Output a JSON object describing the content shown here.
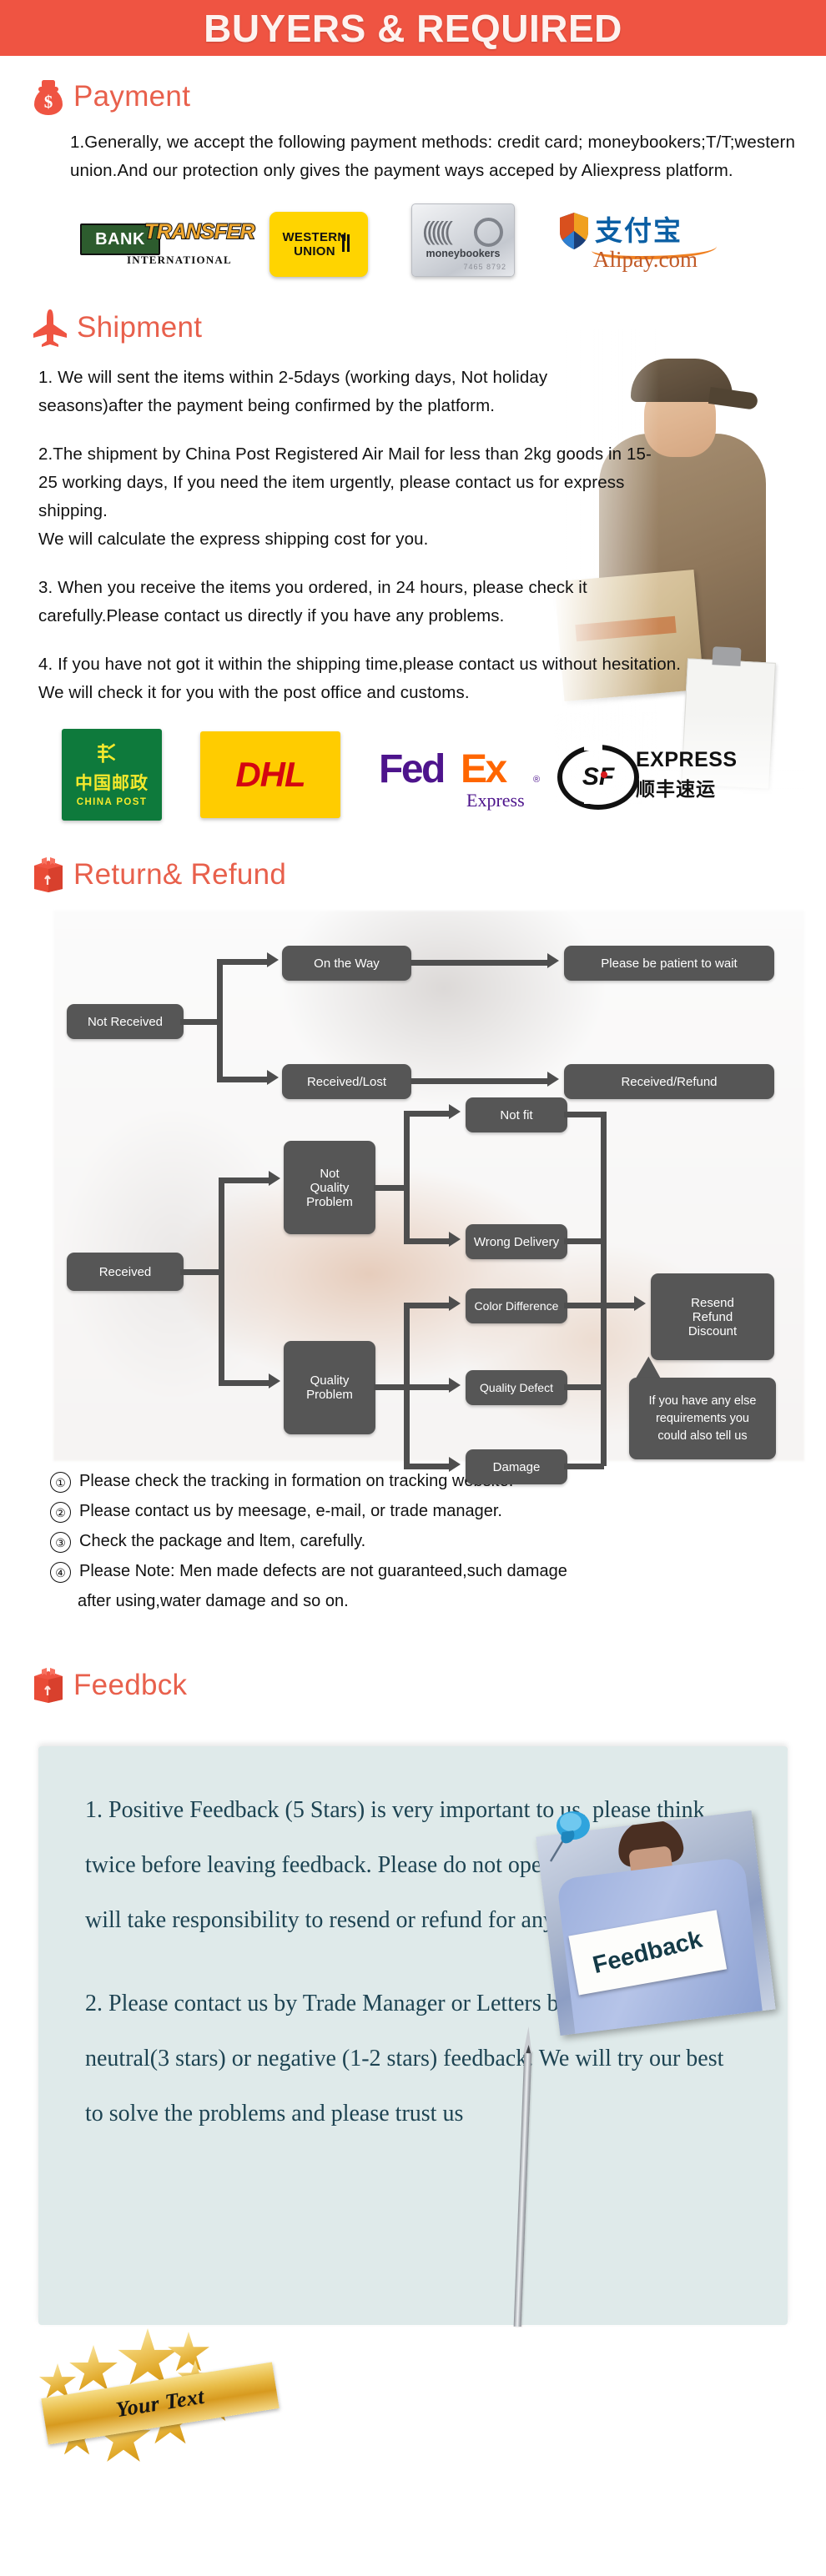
{
  "banner": {
    "title": "BUYERS & REQUIRED"
  },
  "payment": {
    "heading": "Payment",
    "icon": "money-bag-icon",
    "paragraph": "1.Generally, we accept the following payment methods: credit card; moneybookers;T/T;western union.And our protection only gives the payment ways acceped by Aliexpress platform.",
    "logos": [
      {
        "name": "bank-transfer",
        "line1": "BANK",
        "line2": "TRANSFER",
        "line3": "INTERNATIONAL"
      },
      {
        "name": "western-union",
        "line1": "WESTERN",
        "line2": "UNION"
      },
      {
        "name": "moneybookers",
        "line1": "moneybookers",
        "line2": "7465 8792"
      },
      {
        "name": "alipay",
        "line1": "支付宝",
        "line2": "Alipay.com"
      }
    ]
  },
  "shipment": {
    "heading": "Shipment",
    "icon": "airplane-icon",
    "paragraphs": [
      "1. We will sent the items within 2-5days (working days, Not holiday seasons)after the payment being confirmed by the platform.",
      "2.The shipment by China Post Registered Air Mail for less than  2kg goods in 15-25 working days, If  you need the item urgently, please contact us for express shipping.\nWe will calculate the express shipping cost for you.",
      "3. When you receive the items you ordered, in 24 hours, please check  it carefully.Please contact us directly if you have any problems.",
      "4. If you have not got it within the shipping time,please contact us without hesitation. We will check it for you with the post office and customs."
    ],
    "logos": [
      {
        "name": "china-post",
        "line1": "中国邮政",
        "line2": "CHINA POST"
      },
      {
        "name": "dhl",
        "line1": "DHL"
      },
      {
        "name": "fedex",
        "line1": "Fed",
        "line2": "Ex",
        "line3": "Express",
        "line4": "®"
      },
      {
        "name": "sf-express",
        "line1": "SF",
        "line2": "EXPRESS",
        "line3": "顺丰速运"
      }
    ]
  },
  "returns": {
    "heading": "Return& Refund",
    "icon": "open-box-icon",
    "flow": {
      "not_received": "Not Received",
      "on_the_way": "On the Way",
      "please_wait": "Please be patient to wait",
      "received_lost": "Received/Lost",
      "received_refund": "Received/Refund",
      "received": "Received",
      "not_quality_problem": "Not\nQuality\nProblem",
      "quality_problem": "Quality\nProblem",
      "not_fit": "Not fit",
      "wrong_delivery": "Wrong Delivery",
      "color_difference": "Color Difference",
      "quality_defect": "Quality Defect",
      "damage": "Damage",
      "resend_refund_discount": "Resend\nRefund\nDiscount",
      "callout": "If you have any else\nrequirements you\ncould also tell us"
    },
    "notes": [
      {
        "num": "①",
        "text": "Please check the tracking in formation on tracking website."
      },
      {
        "num": "②",
        "text": "Please contact us by meesage, e-mail, or trade manager."
      },
      {
        "num": "③",
        "text": "Check the package and ltem, carefully."
      },
      {
        "num": "④",
        "text": "Please Note: Men made defects  are not guaranteed,such damage",
        "cont": "after using,water damage and so on."
      }
    ]
  },
  "feedback": {
    "heading": "Feedbck",
    "icon": "open-box-icon",
    "photo_sign_text": "Feedback",
    "paragraph1": "1. Positive Feedback (5 Stars) is very important to us, please think twice before leaving feedback. Please do not open dispute to us,   we will take responsibility to resend or refund for any problems.",
    "paragraph2": "2. Please contact us by Trade Manager or Letters before leaving neutral(3 stars) or negative (1-2 stars) feedback. We will try our best to solve the problems and please trust us",
    "badge_text": "Your Text"
  },
  "colors": {
    "banner_bg": "#ef5442",
    "heading": "#e8604c",
    "node_bg": "#565656",
    "feedback_bg": "#dfeaea",
    "feedback_text": "#1d4352"
  }
}
